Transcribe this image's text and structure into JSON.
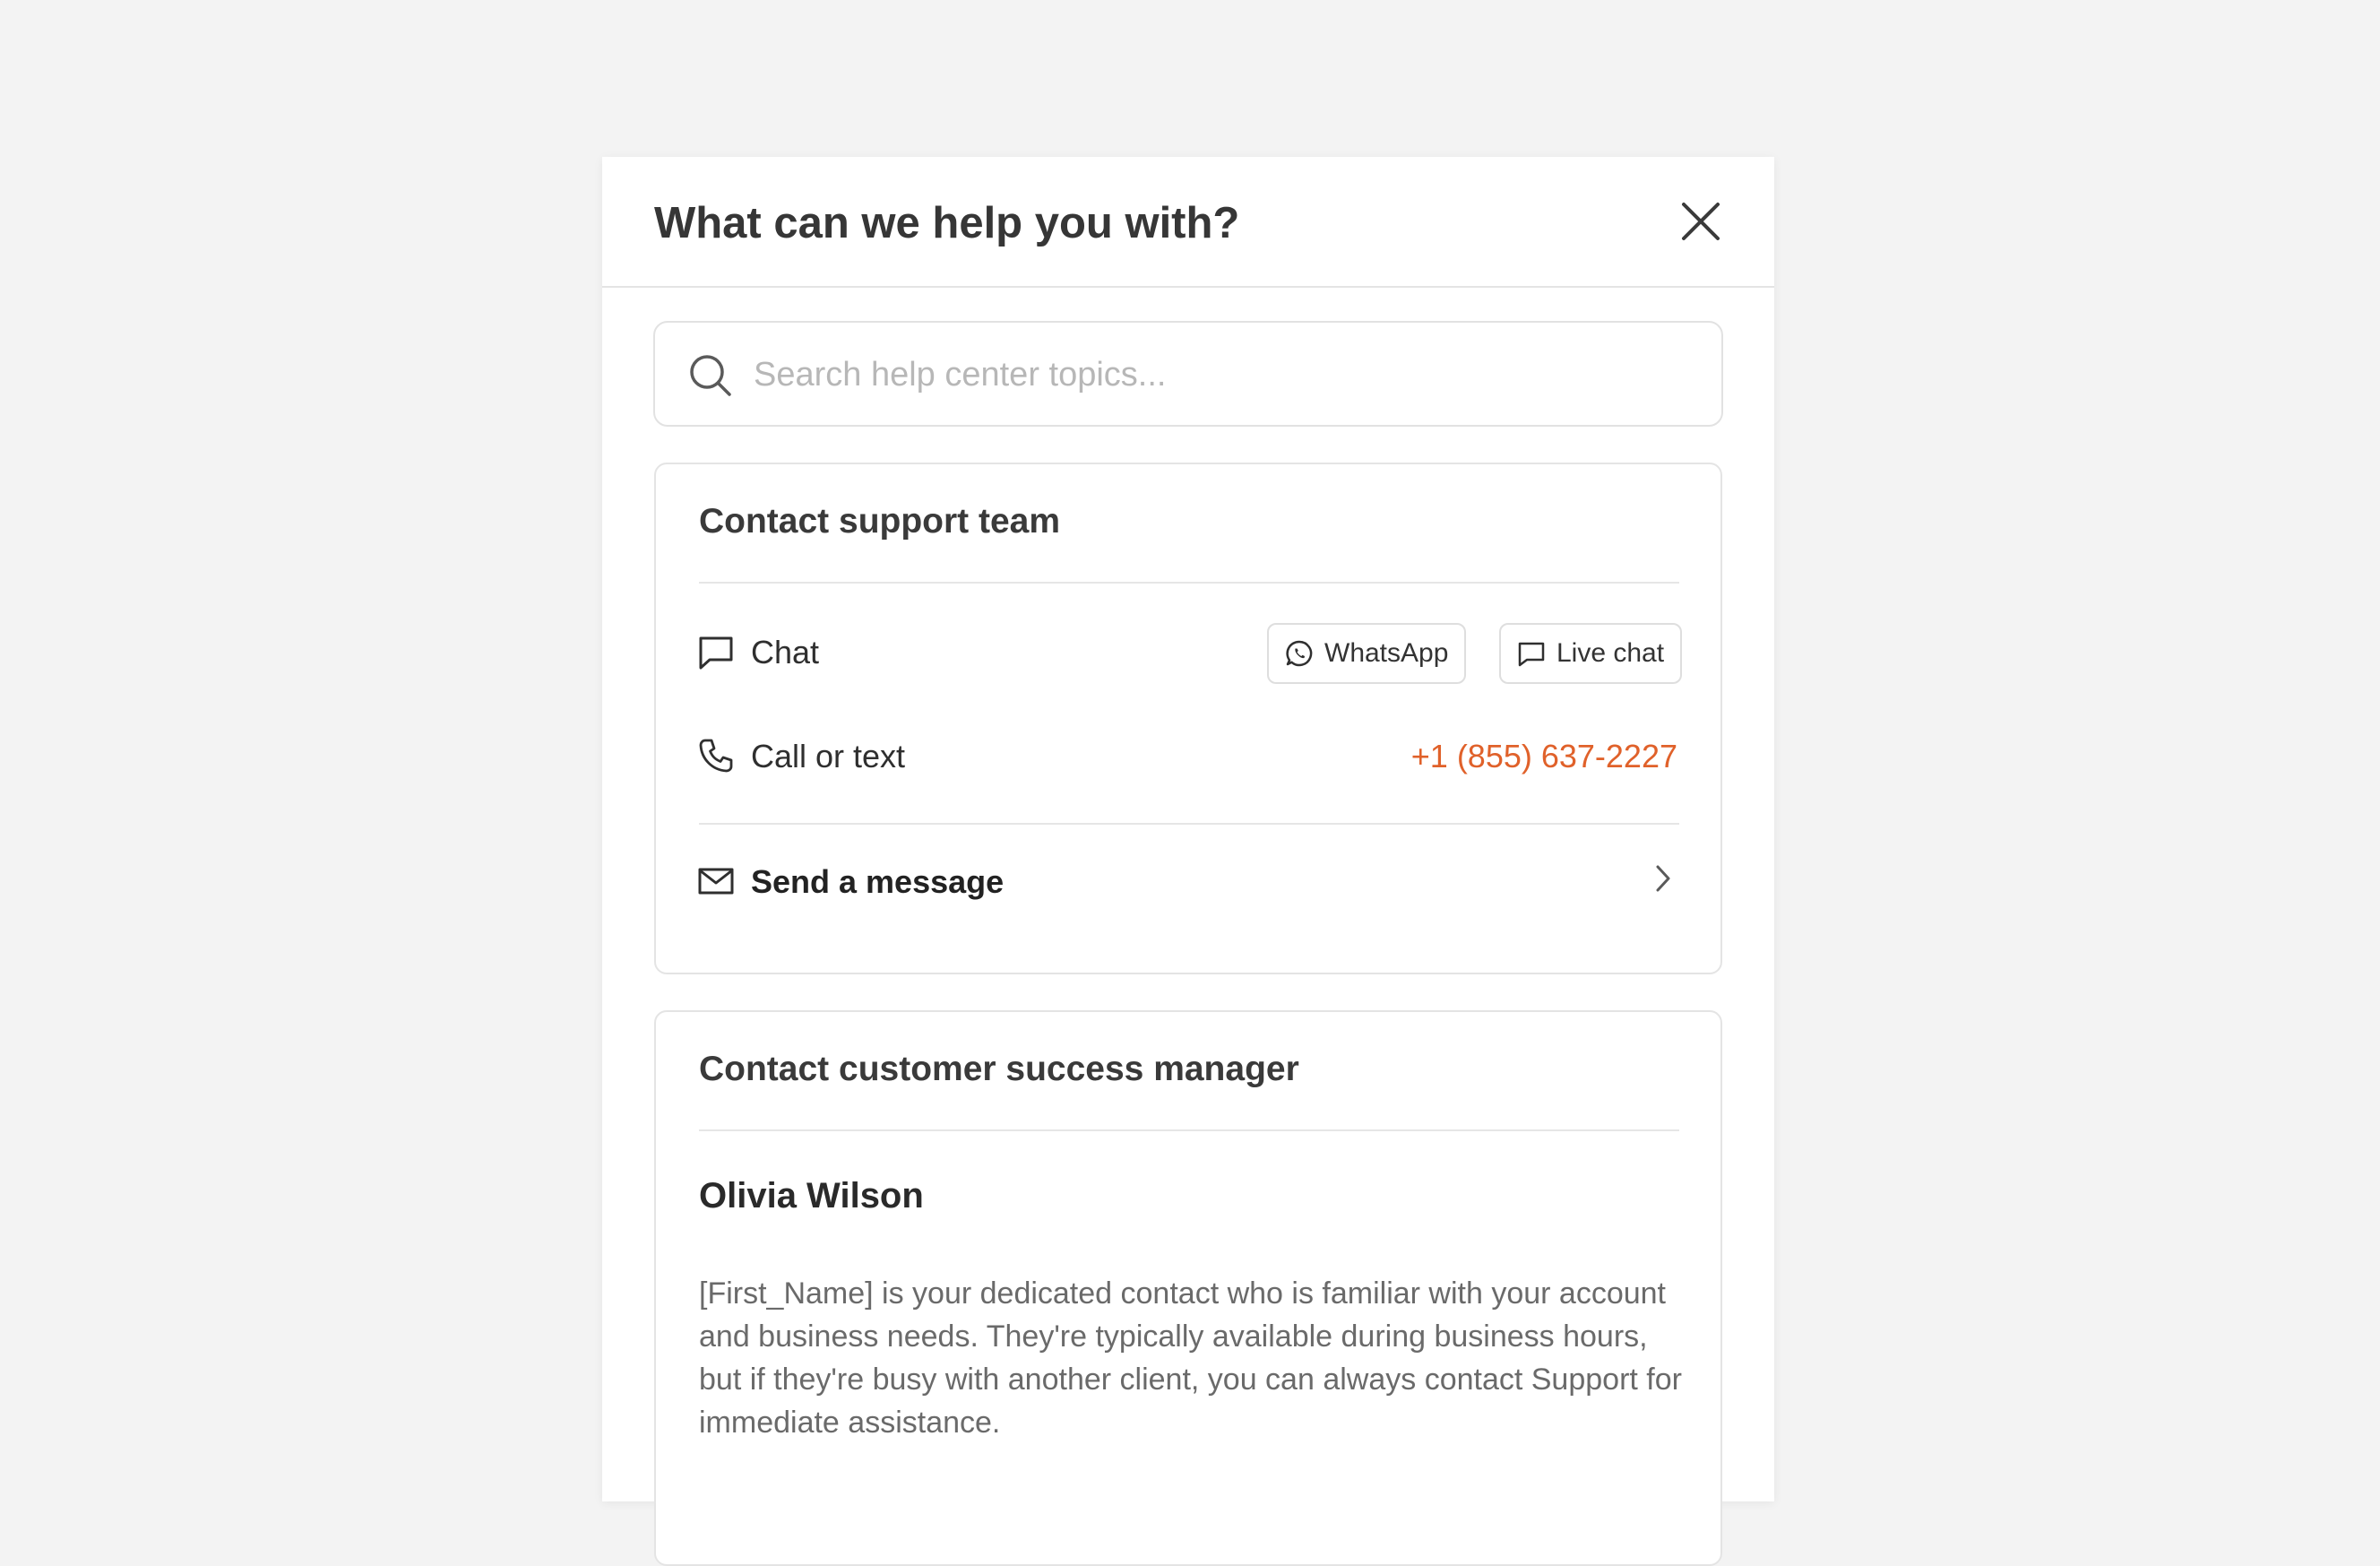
{
  "panel": {
    "title": "What can we help you with?"
  },
  "icons": {
    "close": "close-icon",
    "search": "search-icon",
    "chat": "chat-bubble-icon",
    "whatsapp": "whatsapp-icon",
    "live_chat": "chat-bubble-icon",
    "phone": "phone-icon",
    "mail": "mail-icon",
    "chevron": "chevron-right-icon"
  },
  "search": {
    "placeholder": "Search help center topics...",
    "value": ""
  },
  "support": {
    "title": "Contact support team",
    "chat_label": "Chat",
    "whatsapp_label": "WhatsApp",
    "live_chat_label": "Live chat",
    "call_label": "Call or text",
    "phone_number": "+1 (855) 637-2227",
    "send_message_label": "Send a message"
  },
  "csm": {
    "title": "Contact customer success manager",
    "name": "Olivia Wilson",
    "description": "[First_Name] is your dedicated contact who is familiar with your account and business needs. They're typically available during business hours, but if they're busy with another client, you can always contact Support for immediate assistance."
  },
  "colors": {
    "accent": "#e0612a",
    "background": "#f3f3f3",
    "panel": "#ffffff",
    "border": "#e4e4e4"
  }
}
